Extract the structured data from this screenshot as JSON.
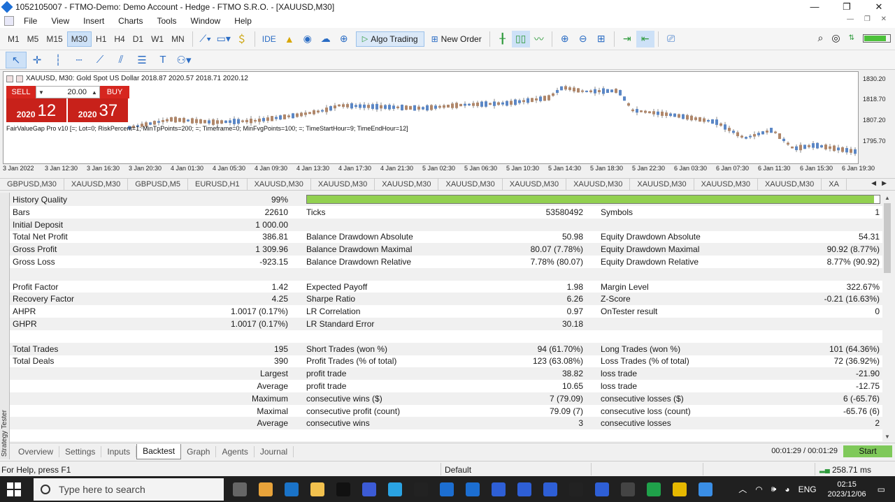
{
  "window": {
    "title": "1052105007 - FTMO-Demo: Demo Account - Hedge - FTMO S.R.O. - [XAUUSD,M30]",
    "minimize": "—",
    "maximize": "❐",
    "close": "✕"
  },
  "menu": [
    "File",
    "View",
    "Insert",
    "Charts",
    "Tools",
    "Window",
    "Help"
  ],
  "toolbar": {
    "timeframes": [
      "M1",
      "M5",
      "M15",
      "M30",
      "H1",
      "H4",
      "D1",
      "W1",
      "MN"
    ],
    "active_timeframe": "M30",
    "ide_label": "IDE",
    "algo_label": "Algo Trading",
    "new_order_label": "New Order",
    "battery_level": 0.85
  },
  "chart": {
    "symbol_line": "XAUUSD, M30:  Gold Spot US Dollar  2018.87 2020.57 2018.71 2020.12",
    "sell_label": "SELL",
    "buy_label": "BUY",
    "lot": "20.00",
    "sell_price_small": "2020",
    "sell_price_big": "12",
    "buy_price_small": "2020",
    "buy_price_big": "37",
    "indicator": "FairValueGap Pro v10 [=; Lot=0; RiskPercent=1; MinTpPoints=200; =; Timeframe=0; MinFvgPoints=100; =; TimeStartHour=9; TimeEndHour=12]",
    "time_labels": [
      "3 Jan 2022",
      "3 Jan 12:30",
      "3 Jan 16:30",
      "3 Jan 20:30",
      "4 Jan 01:30",
      "4 Jan 05:30",
      "4 Jan 09:30",
      "4 Jan 13:30",
      "4 Jan 17:30",
      "4 Jan 21:30",
      "5 Jan 02:30",
      "5 Jan 06:30",
      "5 Jan 10:30",
      "5 Jan 14:30",
      "5 Jan 18:30",
      "5 Jan 22:30",
      "6 Jan 03:30",
      "6 Jan 07:30",
      "6 Jan 11:30",
      "6 Jan 15:30",
      "6 Jan 19:30"
    ],
    "price_labels": [
      "1830.20",
      "1818.70",
      "1807.20",
      "1795.70"
    ],
    "bull_color": "#5b87c6",
    "bear_color": "#b0876a"
  },
  "chart_tabs": [
    "GBPUSD,M30",
    "XAUUSD,M30",
    "GBPUSD,M5",
    "EURUSD,H1",
    "XAUUSD,M30",
    "XAUUSD,M30",
    "XAUUSD,M30",
    "XAUUSD,M30",
    "XAUUSD,M30",
    "XAUUSD,M30",
    "XAUUSD,M30",
    "XAUUSD,M30",
    "XAUUSD,M30",
    "XA"
  ],
  "report": {
    "history_quality_label": "History Quality",
    "history_quality_value": "99%",
    "history_quality_fraction": 0.99,
    "rows": [
      [
        "Bars",
        "22610",
        "Ticks",
        "53580492",
        "Symbols",
        "1"
      ],
      [
        "Initial Deposit",
        "1 000.00",
        "",
        "",
        "",
        ""
      ],
      [
        "Total Net Profit",
        "386.81",
        "Balance Drawdown Absolute",
        "50.98",
        "Equity Drawdown Absolute",
        "54.31"
      ],
      [
        "Gross Profit",
        "1 309.96",
        "Balance Drawdown Maximal",
        "80.07 (7.78%)",
        "Equity Drawdown Maximal",
        "90.92 (8.77%)"
      ],
      [
        "Gross Loss",
        "-923.15",
        "Balance Drawdown Relative",
        "7.78% (80.07)",
        "Equity Drawdown Relative",
        "8.77% (90.92)"
      ],
      [
        "",
        "",
        "",
        "",
        "",
        ""
      ],
      [
        "Profit Factor",
        "1.42",
        "Expected Payoff",
        "1.98",
        "Margin Level",
        "322.67%"
      ],
      [
        "Recovery Factor",
        "4.25",
        "Sharpe Ratio",
        "6.26",
        "Z-Score",
        "-0.21 (16.63%)"
      ],
      [
        "AHPR",
        "1.0017 (0.17%)",
        "LR Correlation",
        "0.97",
        "OnTester result",
        "0"
      ],
      [
        "GHPR",
        "1.0017 (0.17%)",
        "LR Standard Error",
        "30.18",
        "",
        ""
      ],
      [
        "",
        "",
        "",
        "",
        "",
        ""
      ],
      [
        "Total Trades",
        "195",
        "Short Trades (won %)",
        "94 (61.70%)",
        "Long Trades (won %)",
        "101 (64.36%)"
      ],
      [
        "Total Deals",
        "390",
        "Profit Trades (% of total)",
        "123 (63.08%)",
        "Loss Trades (% of total)",
        "72 (36.92%)"
      ],
      [
        "",
        "Largest",
        "profit trade",
        "38.82",
        "loss trade",
        "-21.90"
      ],
      [
        "",
        "Average",
        "profit trade",
        "10.65",
        "loss trade",
        "-12.75"
      ],
      [
        "",
        "Maximum",
        "consecutive wins ($)",
        "7 (79.09)",
        "consecutive losses ($)",
        "6 (-65.76)"
      ],
      [
        "",
        "Maximal",
        "consecutive profit (count)",
        "79.09 (7)",
        "consecutive loss (count)",
        "-65.76 (6)"
      ],
      [
        "",
        "Average",
        "consecutive wins",
        "3",
        "consecutive losses",
        "2"
      ]
    ]
  },
  "tester": {
    "sidebar_label": "Strategy Tester",
    "tabs": [
      "Overview",
      "Settings",
      "Inputs",
      "Backtest",
      "Graph",
      "Agents",
      "Journal"
    ],
    "active_tab": "Backtest",
    "time": "00:01:29 / 00:01:29",
    "start_label": "Start"
  },
  "status": {
    "help": "For Help, press F1",
    "profile": "Default",
    "ping": "258.71 ms"
  },
  "taskbar": {
    "search_placeholder": "Type here to search",
    "language": "ENG",
    "time": "02:15",
    "date": "2023/12/06",
    "icons": [
      "task-view",
      "chrome",
      "outlook",
      "file-explorer",
      "capcut",
      "remote-app",
      "telegram",
      "mt-terminal",
      "tg-app",
      "pycharm",
      "metaeditor-1",
      "metaeditor-2",
      "metaeditor-3",
      "sierra-chart",
      "metaeditor-4",
      "obs",
      "stock-app",
      "yellow-app",
      "blue-app"
    ]
  }
}
